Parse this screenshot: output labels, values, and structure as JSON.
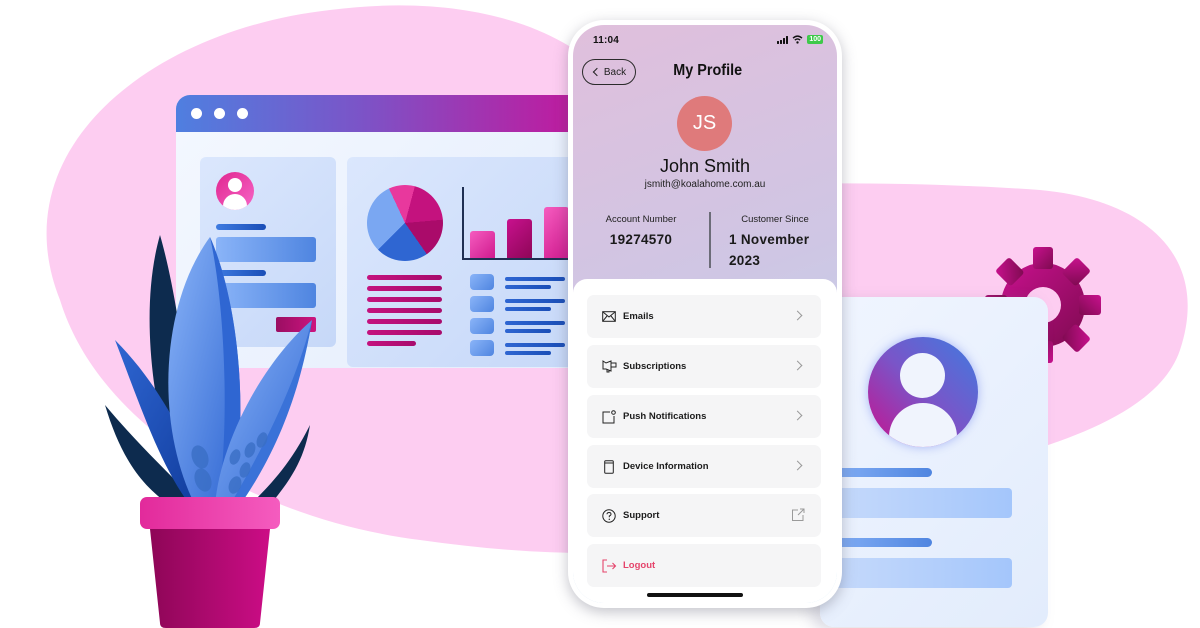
{
  "colors": {
    "blob": "#fdcdf1",
    "accent_magenta": "#c8118e",
    "accent_blue": "#3f7be0",
    "avatar_bg": "#df7a7b",
    "logout_red": "#e5446b",
    "battery_green": "#3ec94a"
  },
  "status_bar": {
    "time": "11:04",
    "battery": "100",
    "icons": [
      "signal-icon",
      "wifi-icon",
      "battery-icon"
    ]
  },
  "header": {
    "back_label": "Back",
    "title": "My Profile"
  },
  "profile": {
    "initials": "JS",
    "name": "John Smith",
    "email": "jsmith@koalahome.com.au"
  },
  "account": {
    "number_label": "Account Number",
    "number_value": "19274570",
    "since_label": "Customer Since",
    "since_value_line1": "1 November",
    "since_value_line2": "2023"
  },
  "menu": {
    "items": [
      {
        "label": "Emails",
        "icon": "envelope-icon",
        "trailing": "chevron-right-icon"
      },
      {
        "label": "Subscriptions",
        "icon": "megaphone-icon",
        "trailing": "chevron-right-icon"
      },
      {
        "label": "Push Notifications",
        "icon": "notification-icon",
        "trailing": "chevron-right-icon"
      },
      {
        "label": "Device Information",
        "icon": "device-icon",
        "trailing": "chevron-right-icon"
      },
      {
        "label": "Support",
        "icon": "help-circle-icon",
        "trailing": "external-link-icon"
      },
      {
        "label": "Logout",
        "icon": "logout-icon",
        "trailing": ""
      }
    ]
  },
  "illustration": {
    "browser_dots": 3,
    "mini_bar_chart_relative_heights": [
      0.45,
      0.65,
      0.85
    ],
    "decor": [
      "pink-blob",
      "browser-window",
      "potted-plant",
      "gear-icon",
      "profile-card"
    ]
  }
}
